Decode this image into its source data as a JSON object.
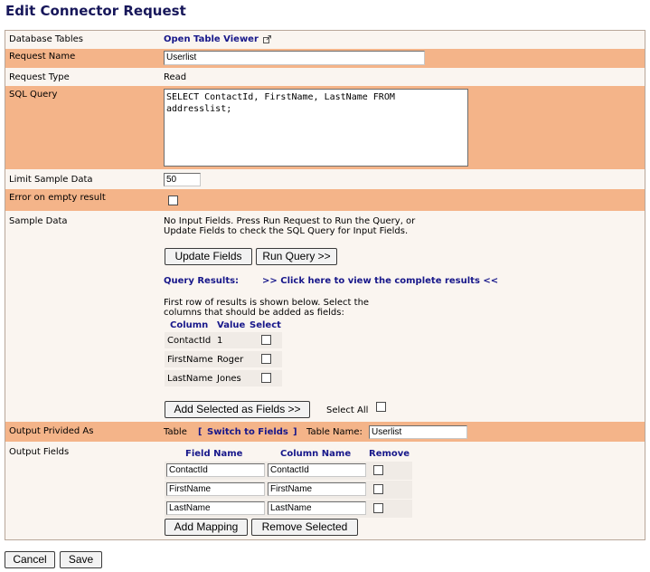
{
  "page": {
    "title": "Edit Connector Request"
  },
  "rows": {
    "database_tables": {
      "label": "Database Tables",
      "link": "Open Table Viewer"
    },
    "request_name": {
      "label": "Request Name",
      "value": "Userlist"
    },
    "request_type": {
      "label": "Request Type",
      "value": "Read"
    },
    "sql_query": {
      "label": "SQL Query",
      "value": "SELECT ContactId, FirstName, LastName FROM\naddresslist;"
    },
    "limit_sample": {
      "label": "Limit Sample Data",
      "value": "50"
    },
    "error_empty": {
      "label": "Error on empty result"
    },
    "sample_data": {
      "label": "Sample Data",
      "info_line1": "No Input Fields. Press Run Request to Run the Query, or",
      "info_line2": "Update Fields to check the SQL Query for Input Fields.",
      "update_button": "Update Fields",
      "run_button": "Run Query >>",
      "results_prefix": "Query Results:",
      "results_link": ">> Click here to view the complete results <<",
      "hint_line1": "First row of results is shown below. Select the",
      "hint_line2": "columns that should be added as fields:",
      "headers": {
        "column": "Column",
        "value": "Value",
        "select": "Select"
      },
      "results": [
        {
          "column": "ContactId",
          "value": "1"
        },
        {
          "column": "FirstName",
          "value": "Roger"
        },
        {
          "column": "LastName",
          "value": "Jones"
        }
      ],
      "add_button": "Add Selected as Fields >>",
      "select_all": "Select All"
    },
    "output_provided": {
      "label": "Output Privided As",
      "type": "Table",
      "switch_open": "[",
      "switch_link": "Switch to Fields",
      "switch_close": "]",
      "table_name_label": "Table Name:",
      "table_name": "Userlist"
    },
    "output_fields": {
      "label": "Output Fields",
      "headers": {
        "field": "Field Name",
        "column": "Column Name",
        "remove": "Remove"
      },
      "mappings": [
        {
          "field": "ContactId",
          "column": "ContactId"
        },
        {
          "field": "FirstName",
          "column": "FirstName"
        },
        {
          "field": "LastName",
          "column": "LastName"
        }
      ],
      "add_button": "Add Mapping",
      "remove_button": "Remove Selected"
    }
  },
  "footer": {
    "cancel": "Cancel",
    "save": "Save"
  }
}
